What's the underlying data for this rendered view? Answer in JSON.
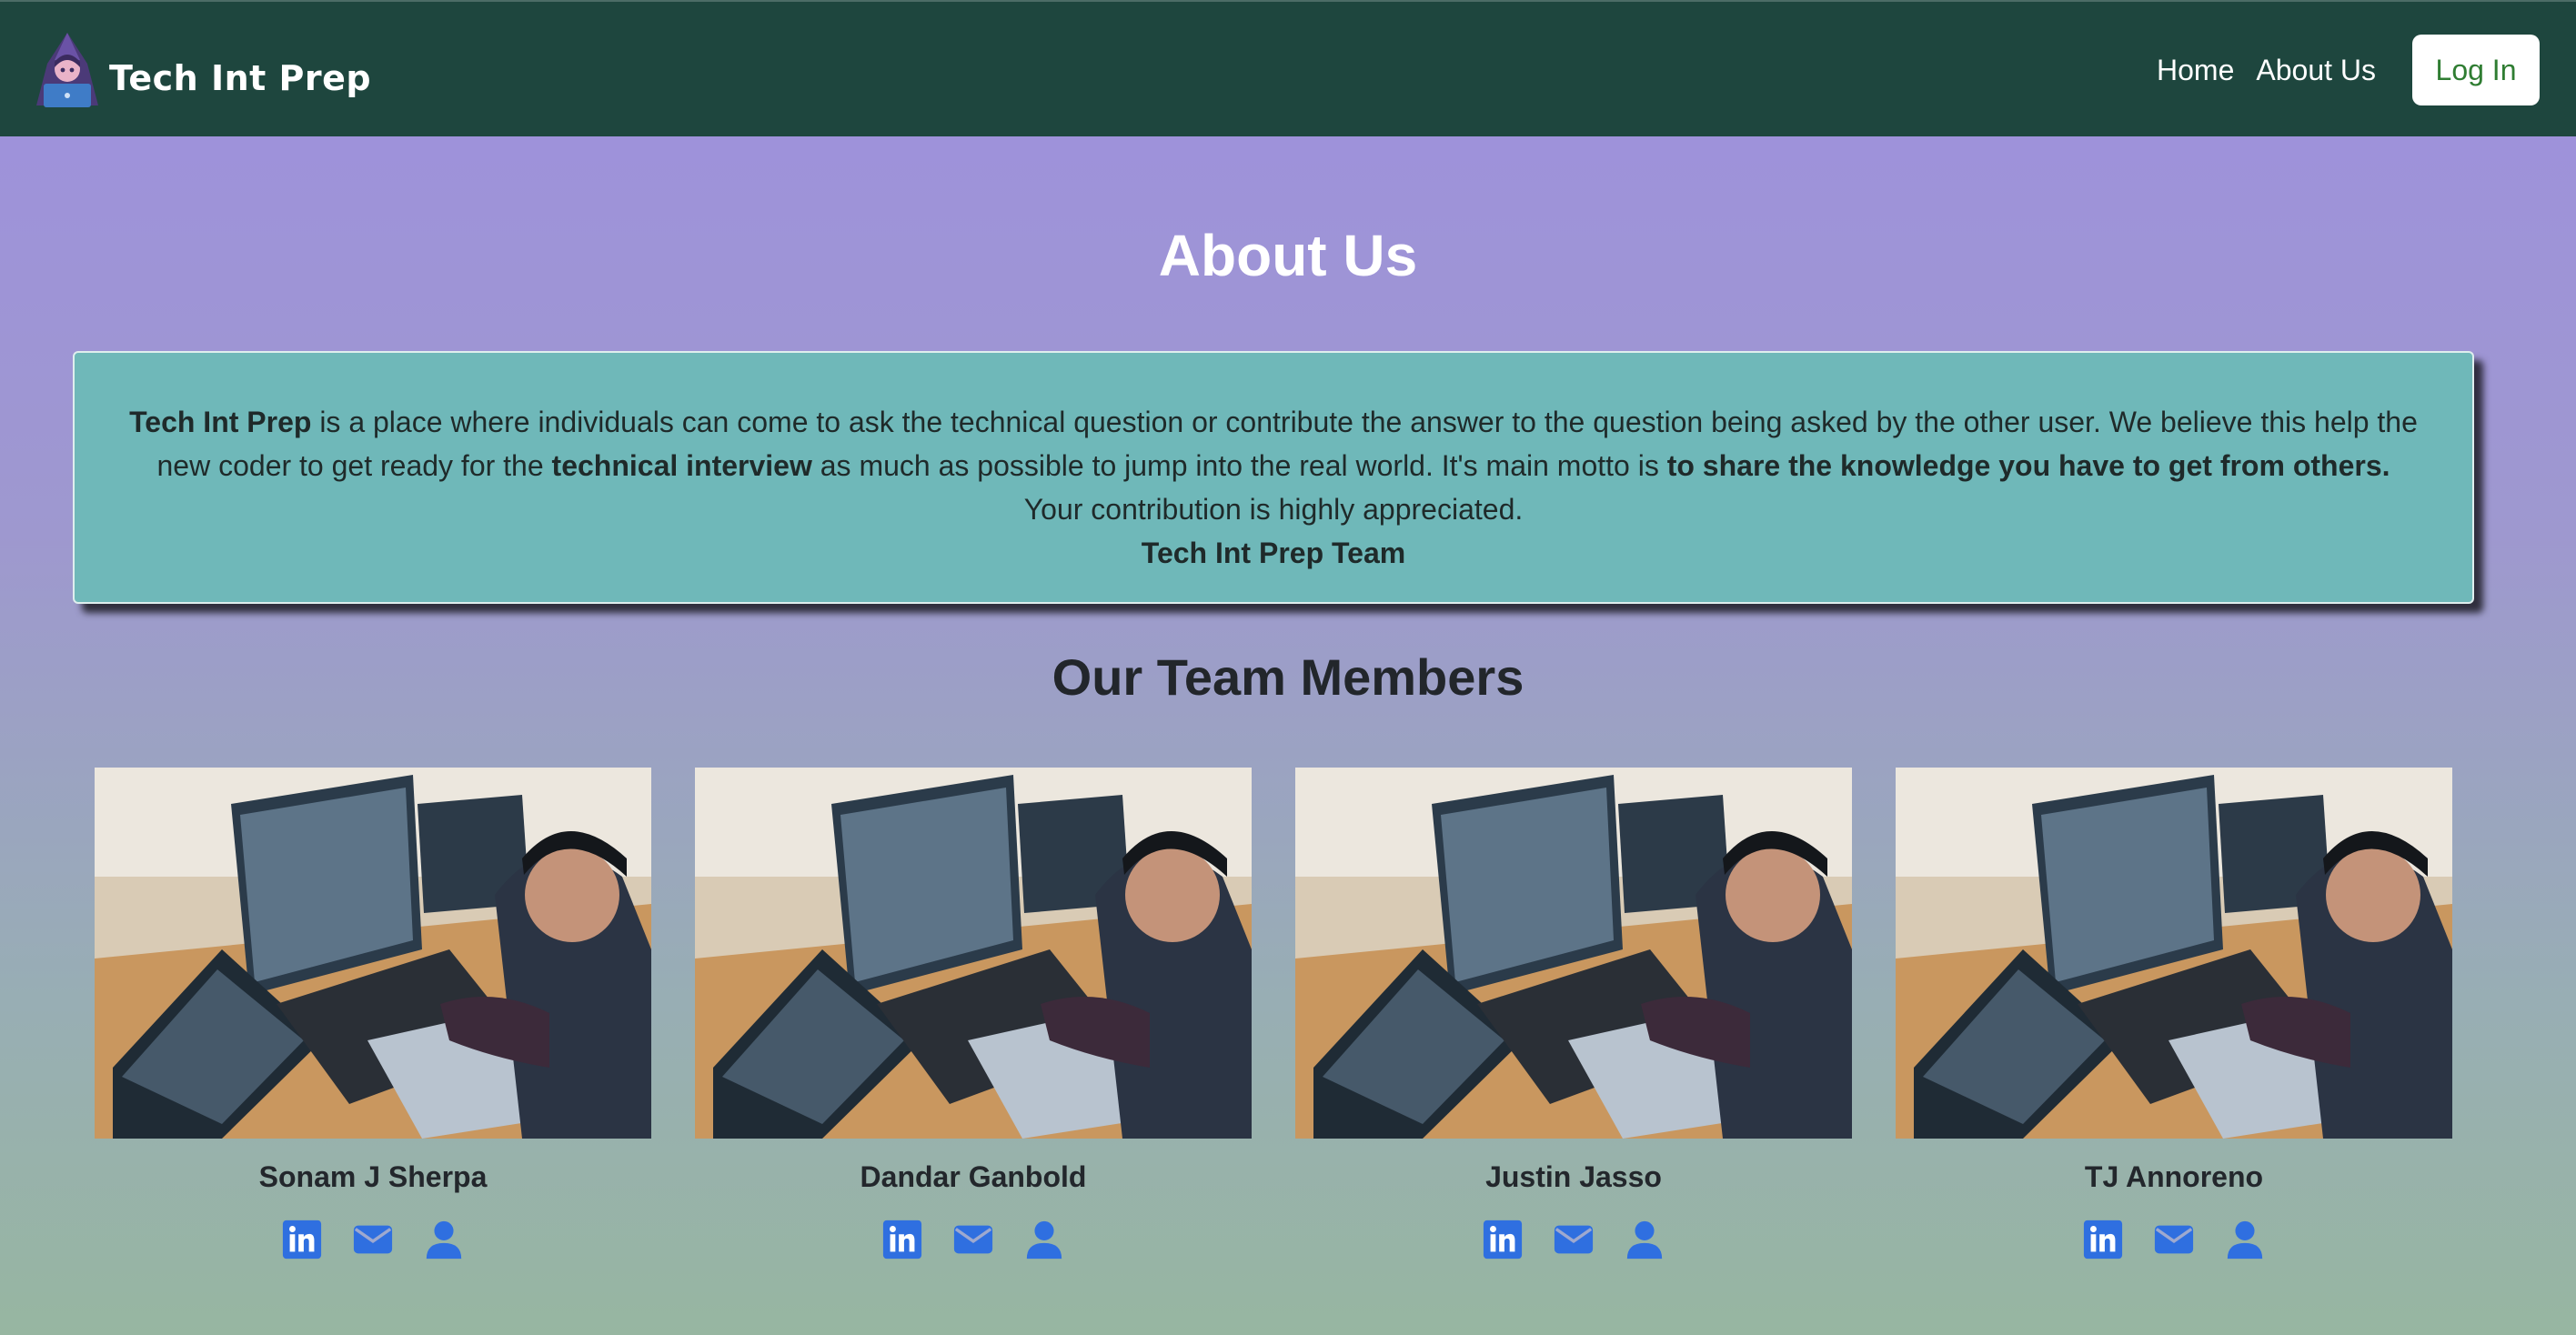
{
  "navbar": {
    "brand": "Tech Int Prep",
    "links": [
      "Home",
      "About Us"
    ],
    "login_label": "Log In"
  },
  "about": {
    "title": "About Us",
    "p1_bold": "Tech Int Prep",
    "p1_a": " is a place where individuals can come to ask the technical question or contribute the answer to the question being asked by the other user. We believe this help the new coder to get ready for the ",
    "p1_bold2": "technical interview",
    "p1_b": " as much as possible to jump into the real world. It's main motto is ",
    "p1_bold3": "to share the knowledge you have to get from others.",
    "p2": "Your contribution is highly appreciated.",
    "signature": "Tech Int Prep Team"
  },
  "team": {
    "title": "Our Team Members",
    "members": [
      {
        "name": "Sonam J Sherpa"
      },
      {
        "name": "Dandar Ganbold"
      },
      {
        "name": "Justin Jasso"
      },
      {
        "name": "TJ Annoreno"
      }
    ],
    "icons": [
      "linkedin-icon",
      "envelope-icon",
      "user-icon"
    ],
    "icon_color": "#2f6fe0"
  },
  "colors": {
    "navbar": "#1e463e",
    "about_box": "#6fb8b9",
    "login_text": "#2f7d32"
  }
}
